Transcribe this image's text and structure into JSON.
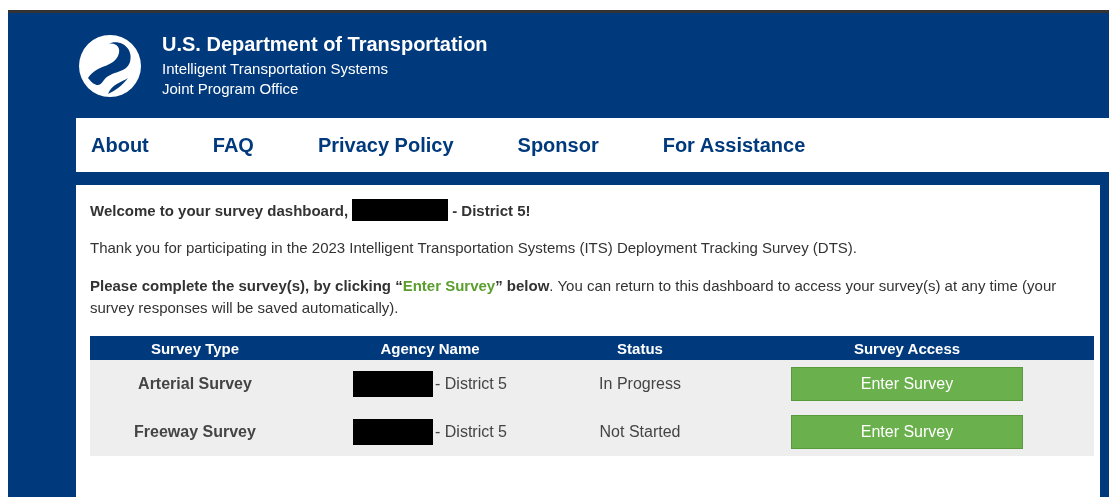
{
  "header": {
    "title": "U.S. Department of Transportation",
    "subtitle_1": "Intelligent Transportation Systems",
    "subtitle_2": "Joint Program Office"
  },
  "nav": [
    {
      "label": "About"
    },
    {
      "label": "FAQ"
    },
    {
      "label": "Privacy Policy"
    },
    {
      "label": "Sponsor"
    },
    {
      "label": "For Assistance"
    }
  ],
  "welcome": {
    "before": "Welcome to your survey dashboard,",
    "after": "- District 5!"
  },
  "intro": "Thank you for participating in the 2023 Intelligent Transportation Systems (ITS) Deployment Tracking Survey (DTS).",
  "instruction": {
    "before": "**Please complete the survey(s), by clicking “**",
    "highlight": "Enter Survey",
    "after": "**” below**. You can return to this dashboard to access your survey(s) at any time (your survey responses will be saved automatically)."
  },
  "table": {
    "columns": [
      "Survey Type",
      "Agency Name",
      "Status",
      "Survey Access"
    ],
    "rows": [
      {
        "survey_type": "Arterial Survey",
        "agency_suffix": "- District 5",
        "status": "In Progress",
        "action": "Enter Survey"
      },
      {
        "survey_type": "Freeway Survey",
        "agency_suffix": "- District 5",
        "status": "Not Started",
        "action": "Enter Survey"
      }
    ]
  }
}
